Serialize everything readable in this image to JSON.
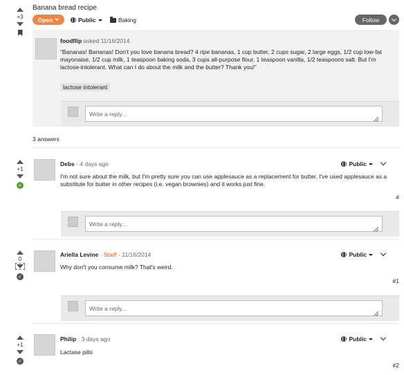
{
  "question": {
    "title": "Banana bread recipe",
    "score": "+3",
    "status": "Open",
    "visibility": "Public",
    "category": "Baking",
    "follow_label": "Follow",
    "author": "foodflip",
    "asked_text": "asked 11/16/2014",
    "body": "“Bananas! Bananas! Don't you love banana bread?   4 ripe bananas, 1 cup butter, 2 cups sugar, 2 large eggs, 1/2 cup low-fat mayonaise, 1/2 cup milk, 1 teaspoon baking soda, 3 cups all-purpose flour, 1 teaspoon vanilla, 1/2 teaspoons salt. But I'm lactose-intolerant. What can I do about the milk and the butter? Thank you!”",
    "tag": "lactose intolerant",
    "reply_placeholder": "Write a reply..."
  },
  "answers_count": "3 answers",
  "answers": [
    {
      "score": "+1",
      "accepted": true,
      "author": "Debs",
      "sep": "·",
      "time": "4 days ago",
      "staff": "",
      "visibility": "Public",
      "body": "I'm not sure about the milk, but I'm pretty sure you can use applesauce as a replacement for butter. I've used applesauce as a substitute for butter in other recipes (i.e. vegan brownies) and it works just fine.",
      "number": "#",
      "reply_placeholder": "Write a reply..."
    },
    {
      "score": "0",
      "accepted": false,
      "author": "Ariella Levine",
      "sep": "·",
      "staff": "Staff",
      "time": "11/16/2014",
      "visibility": "Public",
      "body": "Why don't you consume milk? That's weird.",
      "number": "#1",
      "reply_placeholder": "Write a reply..."
    },
    {
      "score": "+1",
      "accepted": false,
      "author": "Philip",
      "sep": "·",
      "time": "3 days ago",
      "staff": "",
      "visibility": "Public",
      "body": "Lactase pills",
      "number": "#2"
    }
  ]
}
